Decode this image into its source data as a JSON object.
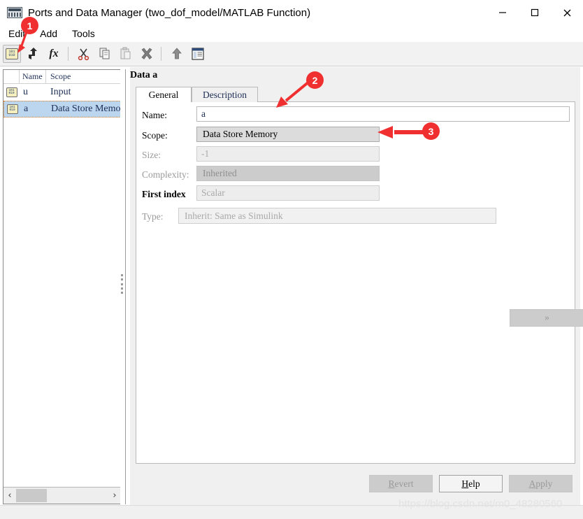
{
  "window": {
    "title": "Ports and Data Manager (two_dof_model/MATLAB Function)",
    "icon": "ports-data-manager-icon",
    "minimize_label": "—",
    "maximize_label": "□",
    "close_label": "✕"
  },
  "menubar": {
    "items": [
      {
        "label": "Edit"
      },
      {
        "label": "Add"
      },
      {
        "label": "Tools"
      }
    ]
  },
  "toolbar": {
    "buttons": [
      {
        "name": "add-data-button",
        "icon": "data-binary-icon",
        "glyph_top": "101",
        "glyph_bottom": "010",
        "active": true
      },
      {
        "name": "add-event-button",
        "icon": "event-arrow-icon"
      },
      {
        "name": "add-function-button",
        "icon": "fx-icon",
        "label": "fx"
      },
      {
        "name": "cut-button",
        "icon": "scissors-icon"
      },
      {
        "name": "copy-button",
        "icon": "copy-icon"
      },
      {
        "name": "paste-button",
        "icon": "paste-icon"
      },
      {
        "name": "delete-button",
        "icon": "x-delete-icon"
      },
      {
        "name": "move-up-button",
        "icon": "arrow-up-icon"
      },
      {
        "name": "model-explorer-button",
        "icon": "explorer-window-icon"
      }
    ]
  },
  "tree": {
    "columns": {
      "gutter": "",
      "name": "Name",
      "scope": "Scope"
    },
    "rows": [
      {
        "icon": "data-binary-icon",
        "name": "u",
        "scope": "Input",
        "selected": false
      },
      {
        "icon": "data-binary-icon",
        "name": "a",
        "scope": "Data Store Memory",
        "selected": true
      }
    ],
    "scrollbar": {
      "left_arrow": "‹",
      "right_arrow": "›"
    }
  },
  "detail": {
    "title": "Data a",
    "tabs": [
      {
        "label": "General",
        "active": true
      },
      {
        "label": "Description",
        "active": false
      }
    ],
    "fields": [
      {
        "label": "Name:",
        "value": "a",
        "control": "textbox",
        "enabled": true
      },
      {
        "label": "Scope:",
        "value": "Data Store Memory",
        "control": "combobox",
        "enabled": true
      },
      {
        "label": "Size:",
        "value": "-1",
        "control": "textbox",
        "enabled": false
      },
      {
        "label": "Complexity:",
        "value": "Inherited",
        "control": "combobox",
        "enabled": false
      },
      {
        "label": "First index",
        "value": "Scalar",
        "control": "textbox",
        "enabled": false
      },
      {
        "label": "Type:",
        "value": "Inherit: Same as Simulink",
        "control": "flatcombo",
        "enabled": false
      }
    ],
    "type_more_button": "»"
  },
  "buttons": {
    "revert": {
      "label": "Revert",
      "mnemonic": "R",
      "enabled": false
    },
    "help": {
      "label": "Help",
      "mnemonic": "H",
      "enabled": true
    },
    "apply": {
      "label": "Apply",
      "mnemonic": "A",
      "enabled": false
    }
  },
  "annotations": [
    {
      "number": "1",
      "target": "add-data-toolbar-button"
    },
    {
      "number": "2",
      "target": "name-textbox"
    },
    {
      "number": "3",
      "target": "scope-combobox"
    }
  ],
  "watermark": "https://blog.csdn.net/m0_48280560",
  "colors": {
    "accent_red": "#f03030",
    "selection_blue": "#bcd6f0",
    "toolbar_bg": "#f2f2f2",
    "panel_bg": "#f0f0f0"
  }
}
